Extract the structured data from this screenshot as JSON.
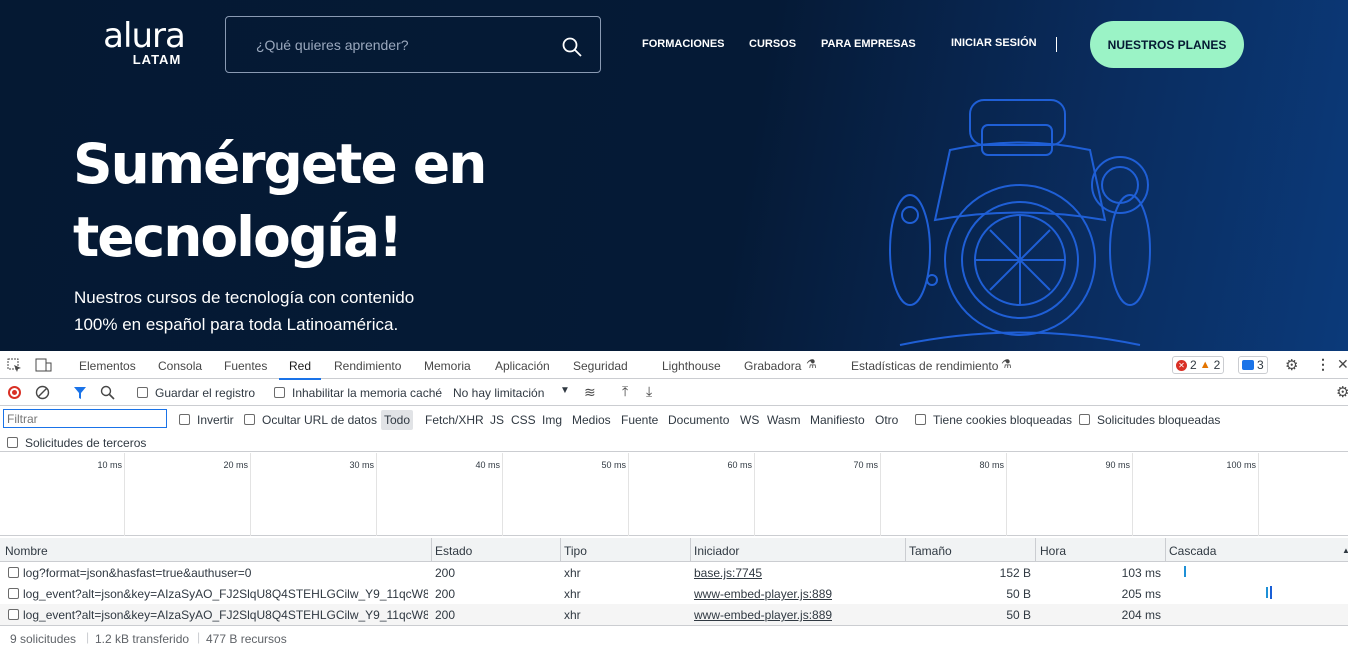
{
  "site": {
    "logo_main": "alura",
    "logo_sub": "LATAM",
    "search_placeholder": "¿Qué quieres aprender?",
    "nav": [
      "FORMACIONES",
      "CURSOS",
      "PARA EMPRESAS",
      "INICIAR SESIÓN"
    ],
    "cta": "NUESTROS PLANES",
    "hero_line1": "Sumérgete en",
    "hero_line2": "tecnología!",
    "sub_line1": "Nuestros cursos de tecnología con contenido",
    "sub_line2": "100% en español para toda Latinoamérica."
  },
  "devtools": {
    "tabs": [
      "Elementos",
      "Consola",
      "Fuentes",
      "Red",
      "Rendimiento",
      "Memoria",
      "Aplicación",
      "Seguridad",
      "Lighthouse",
      "Grabadora",
      "Estadísticas de rendimiento"
    ],
    "active_tab": "Red",
    "errors": "2",
    "warnings": "2",
    "messages": "3",
    "preserve_log": "Guardar el registro",
    "disable_cache": "Inhabilitar la memoria caché",
    "throttling": "No hay limitación",
    "filter_placeholder": "Filtrar",
    "invert": "Invertir",
    "hide_data_urls": "Ocultar URL de datos",
    "type_filters": [
      "Todo",
      "Fetch/XHR",
      "JS",
      "CSS",
      "Img",
      "Medios",
      "Fuente",
      "Documento",
      "WS",
      "Wasm",
      "Manifiesto",
      "Otro"
    ],
    "blocked_cookies": "Tiene cookies bloqueadas",
    "blocked_requests": "Solicitudes bloqueadas",
    "third_party": "Solicitudes de terceros",
    "timeline_ticks": [
      "10 ms",
      "20 ms",
      "30 ms",
      "40 ms",
      "50 ms",
      "60 ms",
      "70 ms",
      "80 ms",
      "90 ms",
      "100 ms"
    ],
    "columns": [
      "Nombre",
      "Estado",
      "Tipo",
      "Iniciador",
      "Tamaño",
      "Hora",
      "Cascada"
    ],
    "rows": [
      {
        "name": "log?format=json&hasfast=true&authuser=0",
        "status": "200",
        "type": "xhr",
        "initiator": "base.js:7745",
        "size": "152 B",
        "time": "103 ms"
      },
      {
        "name": "log_event?alt=json&key=AIzaSyAO_FJ2SlqU8Q4STEHLGCilw_Y9_11qcW8",
        "status": "200",
        "type": "xhr",
        "initiator": "www-embed-player.js:889",
        "size": "50 B",
        "time": "205 ms"
      },
      {
        "name": "log_event?alt=json&key=AIzaSyAO_FJ2SlqU8Q4STEHLGCilw_Y9_11qcW8",
        "status": "200",
        "type": "xhr",
        "initiator": "www-embed-player.js:889",
        "size": "50 B",
        "time": "204 ms"
      }
    ],
    "summary_requests": "9 solicitudes",
    "summary_transferred": "1.2 kB transferido",
    "summary_resources": "477 B recursos"
  }
}
